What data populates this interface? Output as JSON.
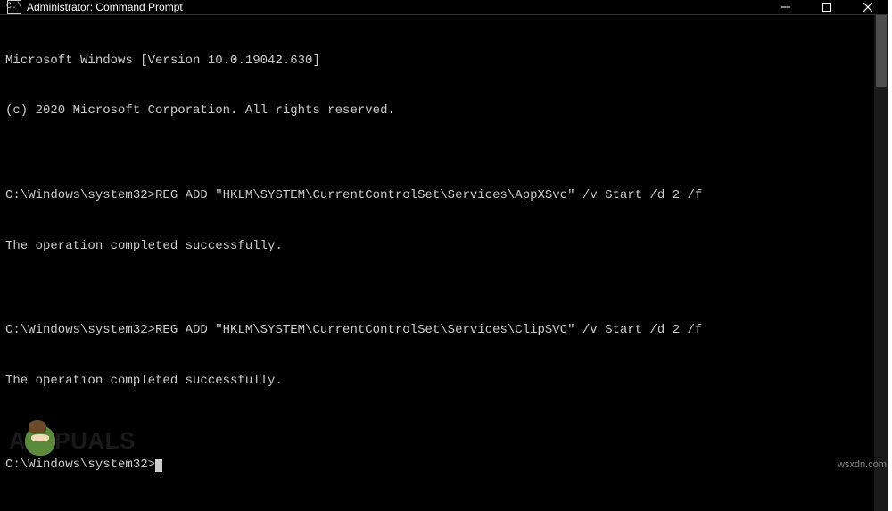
{
  "window": {
    "title": "Administrator: Command Prompt",
    "icon_label": "cmd-icon"
  },
  "terminal": {
    "lines": [
      "Microsoft Windows [Version 10.0.19042.630]",
      "(c) 2020 Microsoft Corporation. All rights reserved.",
      "",
      "C:\\Windows\\system32>REG ADD \"HKLM\\SYSTEM\\CurrentControlSet\\Services\\AppXSvc\" /v Start /d 2 /f",
      "The operation completed successfully.",
      "",
      "C:\\Windows\\system32>REG ADD \"HKLM\\SYSTEM\\CurrentControlSet\\Services\\ClipSVC\" /v Start /d 2 /f",
      "The operation completed successfully.",
      "",
      "C:\\Windows\\system32>"
    ]
  },
  "watermark": {
    "prefix": "A",
    "suffix": "PUALS"
  },
  "attribution": "wsxdn.com"
}
